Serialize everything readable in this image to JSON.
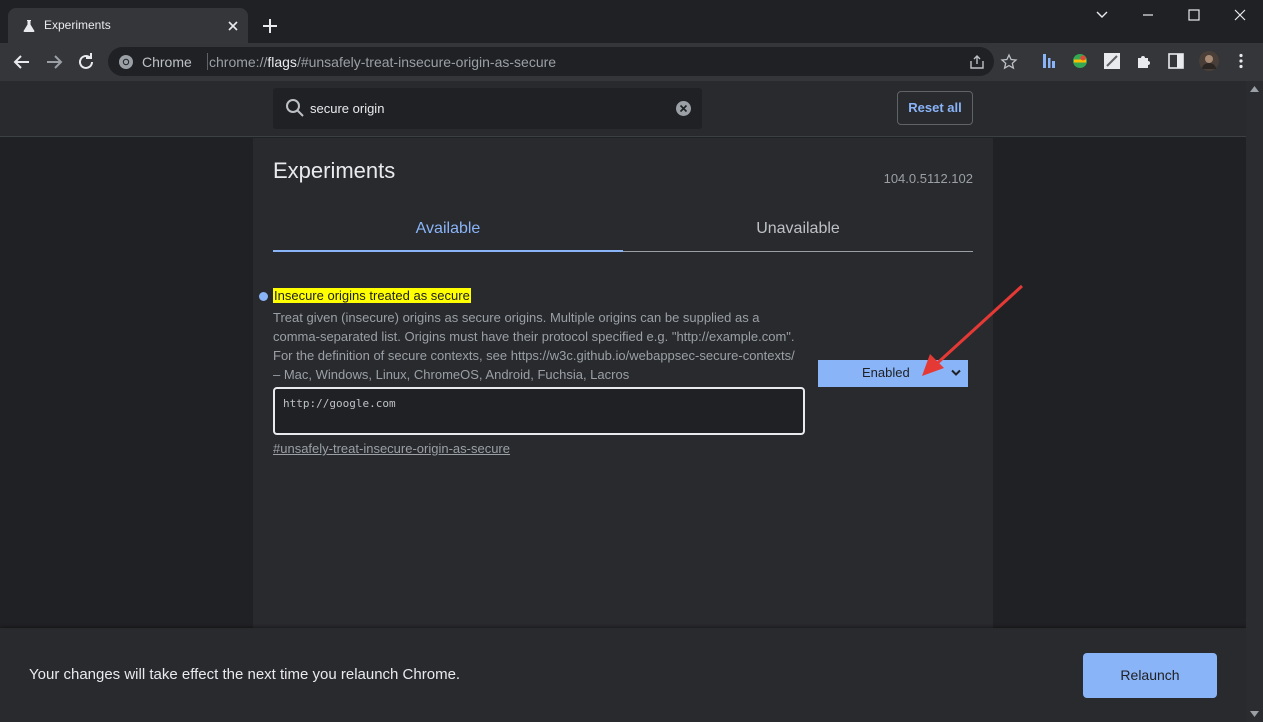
{
  "tab": {
    "title": "Experiments"
  },
  "omnibox": {
    "site_label": "Chrome",
    "url_prefix": "chrome://",
    "url_host": "flags",
    "url_path": "/#unsafely-treat-insecure-origin-as-secure"
  },
  "header": {
    "search_value": "secure origin",
    "reset_label": "Reset all"
  },
  "experiments": {
    "title": "Experiments",
    "version": "104.0.5112.102",
    "tabs": [
      {
        "label": "Available",
        "selected": true
      },
      {
        "label": "Unavailable",
        "selected": false
      }
    ]
  },
  "flag": {
    "name": "Insecure origins treated as secure",
    "description_lines": [
      "Treat given (insecure) origins as secure origins. Multiple origins can be supplied as a",
      "comma-separated list. Origins must have their protocol specified e.g. \"http://example.com\".",
      "For the definition of secure contexts, see https://w3c.github.io/webappsec-secure-contexts/",
      "– Mac, Windows, Linux, ChromeOS, Android, Fuchsia, Lacros"
    ],
    "input_value": "http://google.com",
    "anchor": "#unsafely-treat-insecure-origin-as-secure",
    "select_value": "Enabled"
  },
  "footer": {
    "message": "Your changes will take effect the next time you relaunch Chrome.",
    "relaunch_label": "Relaunch"
  },
  "colors": {
    "accent": "#8ab4f8",
    "highlight": "#ffff00",
    "annotation_arrow": "#e53935"
  }
}
